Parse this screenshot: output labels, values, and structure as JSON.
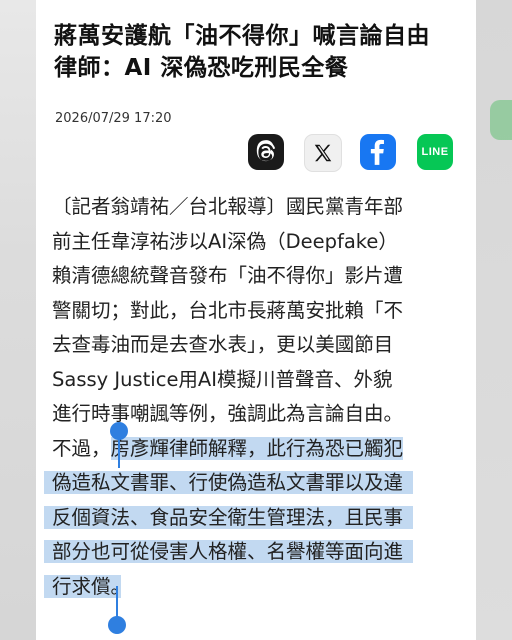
{
  "article": {
    "headline_line1": "蔣萬安護航「油不得你」喊言論自由",
    "headline_line2": "律師：AI 深偽恐吃刑民全餐",
    "timestamp": "2026/07/29 17:20"
  },
  "share": {
    "threads_icon": "threads-icon",
    "x_icon": "x-icon",
    "facebook_icon": "facebook-icon",
    "line_label": "LINE",
    "colors": {
      "facebook": "#1877f2",
      "line": "#06c755",
      "threads": "#1a1a1a"
    }
  },
  "body": {
    "line1": "〔記者翁靖祐／台北報導〕國民黨青年部",
    "line2": "前主任韋淳祐涉以AI深偽（Deepfake）",
    "line3": "賴清德總統聲音發布「油不得你」影片遭",
    "line4": "警關切；對此，台北市長蔣萬安批賴「不",
    "line5": "去查毒油而是去查水表」，更以美國節目",
    "line6": "Sassy Justice用AI模擬川普聲音、外貌",
    "line7": "進行時事嘲諷等例，強調此為言論自由。",
    "line8_pre": "不過，",
    "line8_sel": "房彥輝律師解釋，此行為恐已觸犯",
    "line9": "偽造私文書罪、行使偽造私文書罪以及違",
    "line10": "反個資法、食品安全衛生管理法，且民事",
    "line11": "部分也可從侵害人格權、名譽權等面向進",
    "line12_sel": "行求償",
    "line12_post": "。"
  },
  "selection_color": "#78aae1"
}
